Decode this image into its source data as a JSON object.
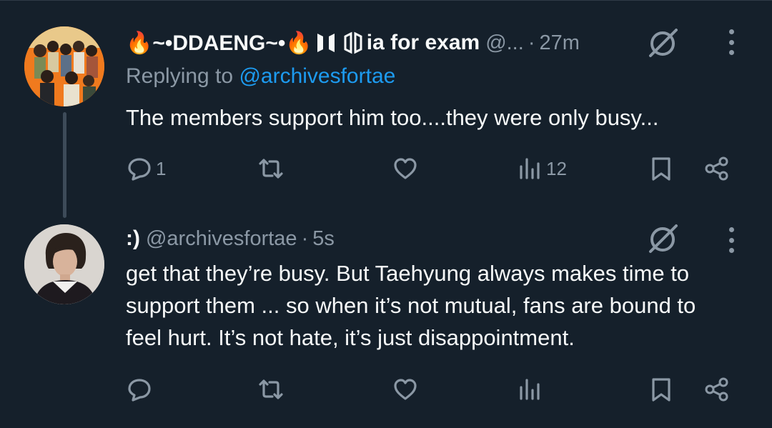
{
  "tweets": [
    {
      "display_name": "🔥~•DDAENG~•🔥",
      "name_suffix": "ia for exam",
      "handle": "@...",
      "time": "27m",
      "replying_label": "Replying to",
      "replying_to": "@archivesfortae",
      "text": "The members support him too....they were only busy...",
      "counts": {
        "reply": "1",
        "retweet": "",
        "like": "",
        "views": "12"
      }
    },
    {
      "display_name": ":)",
      "handle": "@archivesfortae",
      "time": "5s",
      "text_lines": [
        "get that they’re busy. But Taehyung always makes time to",
        "support them ... so when it’s not mutual, fans are bound to",
        "feel hurt. It’s not hate, it’s just disappointment."
      ],
      "counts": {
        "reply": "",
        "retweet": "",
        "like": "",
        "views": ""
      }
    }
  ],
  "separator": "·",
  "icons": [
    "grok-icon",
    "more-options-icon",
    "reply-icon",
    "retweet-icon",
    "like-icon",
    "views-icon",
    "bookmark-icon",
    "share-icon",
    "bts-logo-icon",
    "army-logo-icon"
  ],
  "colors": {
    "background": "#15202b",
    "text": "#f7f9f9",
    "secondary": "#8b98a5",
    "accent": "#1d9bf0"
  }
}
